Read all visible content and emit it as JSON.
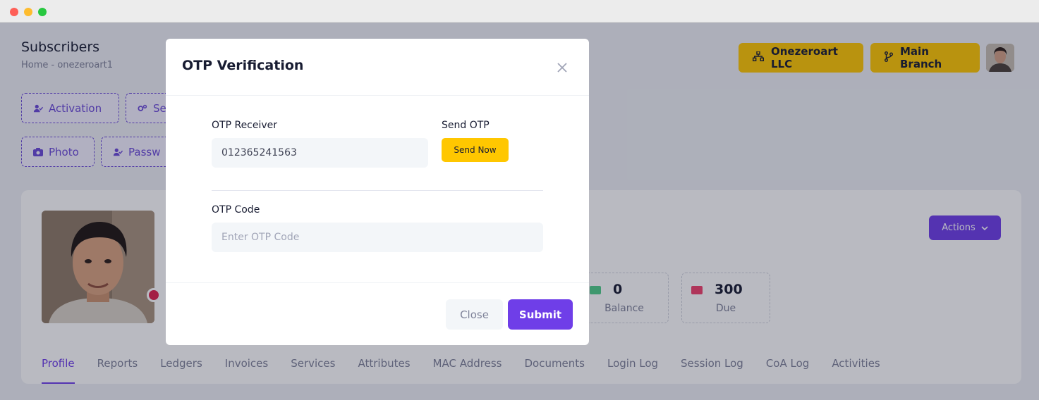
{
  "page": {
    "title": "Subscribers",
    "breadcrumb": "Home  -  onezeroart1"
  },
  "header": {
    "company_label": "Onezeroart LLC",
    "branch_label": "Main Branch"
  },
  "quick_actions": {
    "activation": "Activation",
    "settings_partial": "Se",
    "photo": "Photo",
    "password_partial": "Passw"
  },
  "profile": {
    "actions_label": "Actions",
    "stats": [
      {
        "value": "0",
        "label": "Balance",
        "icon_color": "#50cd89"
      },
      {
        "value": "300",
        "label": "Due",
        "icon_color": "#f1416c"
      }
    ]
  },
  "tabs": [
    "Profile",
    "Reports",
    "Ledgers",
    "Invoices",
    "Services",
    "Attributes",
    "MAC Address",
    "Documents",
    "Login Log",
    "Session Log",
    "CoA Log",
    "Activities"
  ],
  "modal": {
    "title": "OTP Verification",
    "receiver_label": "OTP Receiver",
    "receiver_value": "012365241563",
    "send_label": "Send OTP",
    "send_button": "Send Now",
    "code_label": "OTP Code",
    "code_placeholder": "Enter OTP Code",
    "close_button": "Close",
    "submit_button": "Submit"
  },
  "colors": {
    "accent": "#6f3ee8",
    "warning": "#ffc700",
    "danger": "#f1416c",
    "success": "#50cd89"
  }
}
